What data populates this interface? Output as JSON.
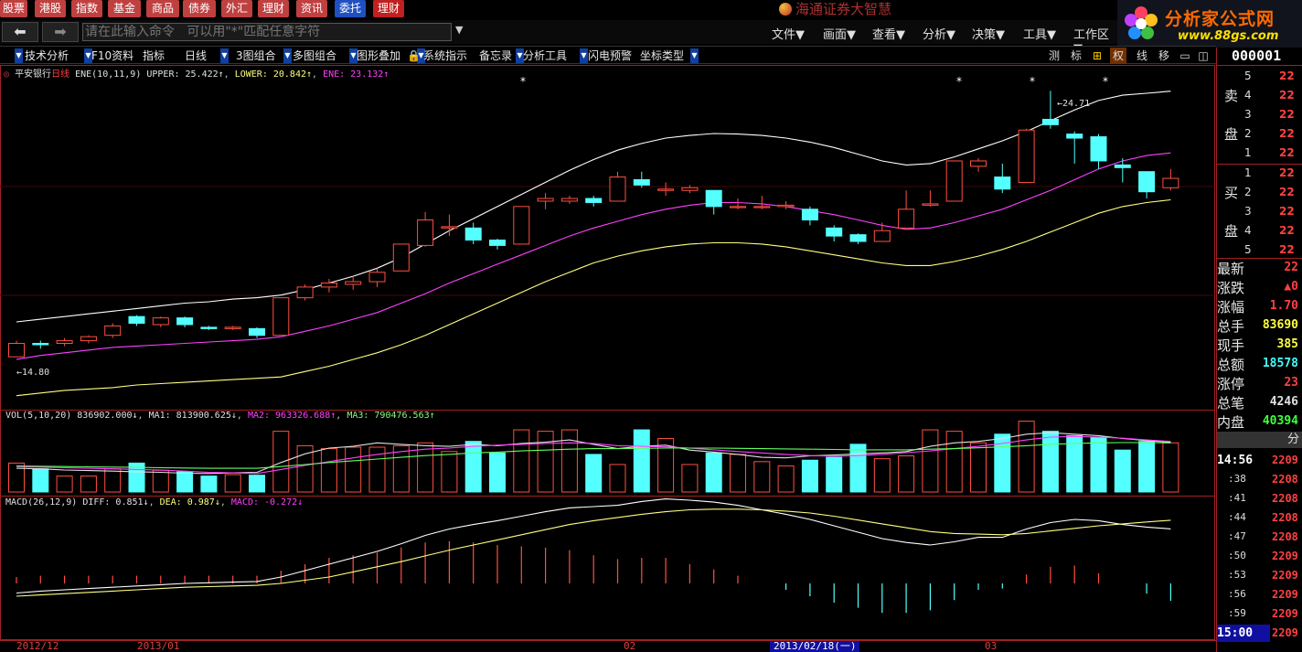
{
  "nav": {
    "tabs": [
      "股票",
      "港股",
      "指数",
      "基金",
      "商品",
      "债券",
      "外汇",
      "理财",
      "资讯",
      "委托",
      "理财"
    ],
    "brand": "海通证券大智慧"
  },
  "site_logo": {
    "title": "分析家公式网",
    "url": "www.88gs.com"
  },
  "command": {
    "placeholder": "请在此输入命令   可以用\"*\"匹配任意字符",
    "menus": [
      "文件▼",
      "画面▼",
      "查看▼",
      "分析▼",
      "决策▼",
      "工具▼",
      "工作区▼"
    ]
  },
  "toolbar": {
    "items": [
      "技术分析",
      "F10资料",
      "指标",
      "日线",
      "3图组合",
      "多图组合",
      "图形叠加",
      "系统指示",
      "备忘录",
      "分析工具",
      "闪电预警",
      "坐标类型"
    ],
    "right_items": [
      "测",
      "标",
      "权",
      "线",
      "移"
    ]
  },
  "stock": {
    "name": "平安银行",
    "period": "日线",
    "code": "000001"
  },
  "ene_legend": {
    "name": "ENE(10,11,9)",
    "upper": "UPPER: 25.422↑",
    "lower": "LOWER: 20.842↑",
    "ene": "ENE: 23.132↑"
  },
  "vol_legend": {
    "name": "VOL(5,10,20)",
    "vol": "836902.000↓",
    "ma1": "MA1: 813900.625↓",
    "ma2": "MA2: 963326.688↑",
    "ma3": "MA3: 790476.563↑"
  },
  "macd_legend": {
    "name": "MACD(26,12,9)",
    "diff": "DIFF: 0.851↓",
    "dea": "DEA: 0.987↓",
    "macd": "MACD: -0.272↓"
  },
  "annotations": {
    "high": "←24.71",
    "low": "←14.80"
  },
  "orderbook": {
    "sell_label": [
      "卖",
      "盘"
    ],
    "buy_label": [
      "买",
      "盘"
    ],
    "sell": [
      {
        "lvl": "5",
        "price": "22"
      },
      {
        "lvl": "4",
        "price": "22"
      },
      {
        "lvl": "3",
        "price": "22"
      },
      {
        "lvl": "2",
        "price": "22"
      },
      {
        "lvl": "1",
        "price": "22"
      }
    ],
    "buy": [
      {
        "lvl": "1",
        "price": "22"
      },
      {
        "lvl": "2",
        "price": "22"
      },
      {
        "lvl": "3",
        "price": "22"
      },
      {
        "lvl": "4",
        "price": "22"
      },
      {
        "lvl": "5",
        "price": "22"
      }
    ]
  },
  "quote": [
    {
      "label": "最新",
      "value": "22",
      "color": "#ff4040"
    },
    {
      "label": "涨跌",
      "value": "▲0",
      "color": "#ff4040"
    },
    {
      "label": "涨幅",
      "value": "1.70",
      "color": "#ff4040"
    },
    {
      "label": "总手",
      "value": "83690",
      "color": "#ffff40"
    },
    {
      "label": "现手",
      "value": "385",
      "color": "#ffff40"
    },
    {
      "label": "总额",
      "value": "18578",
      "color": "#40ffff"
    },
    {
      "label": "涨停",
      "value": "23",
      "color": "#ff4040"
    },
    {
      "label": "总笔",
      "value": "4246",
      "color": "#e0e0e0"
    },
    {
      "label": "内盘",
      "value": "40394",
      "color": "#40ff40"
    }
  ],
  "fen_label": "分",
  "ticks": [
    {
      "t": "14:56",
      "p": "2209"
    },
    {
      "t": ":38",
      "p": "2208"
    },
    {
      "t": ":41",
      "p": "2208"
    },
    {
      "t": ":44",
      "p": "2208"
    },
    {
      "t": ":47",
      "p": "2208"
    },
    {
      "t": ":50",
      "p": "2209"
    },
    {
      "t": ":53",
      "p": "2209"
    },
    {
      "t": ":56",
      "p": "2209"
    },
    {
      "t": ":59",
      "p": "2209"
    },
    {
      "t": "15:00",
      "p": "2209"
    }
  ],
  "dates": [
    "2012/12",
    "2013/01",
    "02",
    "03"
  ],
  "date_selected": "2013/02/18(一)",
  "colors": {
    "up": "#ff5040",
    "down": "#54ffff",
    "upper": "#ffffff",
    "lower": "#ffff80",
    "ene": "#ff40ff",
    "border": "#a02020"
  },
  "chart_data": {
    "type": "candlestick",
    "candles": [
      {
        "o": 14.8,
        "c": 15.3,
        "h": 15.4,
        "l": 14.8
      },
      {
        "o": 15.3,
        "c": 15.25,
        "h": 15.4,
        "l": 15.1
      },
      {
        "o": 15.3,
        "c": 15.4,
        "h": 15.5,
        "l": 15.2
      },
      {
        "o": 15.4,
        "c": 15.55,
        "h": 15.6,
        "l": 15.3
      },
      {
        "o": 15.6,
        "c": 15.95,
        "h": 16.05,
        "l": 15.5
      },
      {
        "o": 16.3,
        "c": 16.05,
        "h": 16.35,
        "l": 15.95
      },
      {
        "o": 16.0,
        "c": 16.25,
        "h": 16.3,
        "l": 15.9
      },
      {
        "o": 16.25,
        "c": 16.0,
        "h": 16.3,
        "l": 15.9
      },
      {
        "o": 15.9,
        "c": 15.85,
        "h": 15.95,
        "l": 15.8
      },
      {
        "o": 15.85,
        "c": 15.9,
        "h": 15.95,
        "l": 15.8
      },
      {
        "o": 15.85,
        "c": 15.6,
        "h": 15.9,
        "l": 15.5
      },
      {
        "o": 15.6,
        "c": 17.0,
        "h": 17.0,
        "l": 15.6
      },
      {
        "o": 17.0,
        "c": 17.4,
        "h": 17.5,
        "l": 16.9
      },
      {
        "o": 17.4,
        "c": 17.55,
        "h": 17.7,
        "l": 17.2
      },
      {
        "o": 17.5,
        "c": 17.6,
        "h": 17.8,
        "l": 17.3
      },
      {
        "o": 17.6,
        "c": 17.95,
        "h": 18.1,
        "l": 17.4
      },
      {
        "o": 18.0,
        "c": 19.0,
        "h": 19.0,
        "l": 18.0
      },
      {
        "o": 18.95,
        "c": 19.9,
        "h": 20.2,
        "l": 18.9
      },
      {
        "o": 19.6,
        "c": 19.65,
        "h": 20.1,
        "l": 19.3
      },
      {
        "o": 19.6,
        "c": 19.15,
        "h": 19.8,
        "l": 19.0
      },
      {
        "o": 19.15,
        "c": 18.95,
        "h": 19.2,
        "l": 18.8
      },
      {
        "o": 19.0,
        "c": 20.4,
        "h": 20.4,
        "l": 19.0
      },
      {
        "o": 20.6,
        "c": 20.7,
        "h": 20.9,
        "l": 20.3
      },
      {
        "o": 20.6,
        "c": 20.7,
        "h": 20.8,
        "l": 20.5
      },
      {
        "o": 20.7,
        "c": 20.55,
        "h": 20.8,
        "l": 20.4
      },
      {
        "o": 20.6,
        "c": 21.5,
        "h": 21.7,
        "l": 20.6
      },
      {
        "o": 21.4,
        "c": 21.2,
        "h": 21.7,
        "l": 21.1
      },
      {
        "o": 21.0,
        "c": 21.05,
        "h": 21.3,
        "l": 20.8
      },
      {
        "o": 21.0,
        "c": 21.1,
        "h": 21.2,
        "l": 20.9
      },
      {
        "o": 21.0,
        "c": 20.4,
        "h": 21.0,
        "l": 20.1
      },
      {
        "o": 20.4,
        "c": 20.4,
        "h": 20.7,
        "l": 20.3
      },
      {
        "o": 20.4,
        "c": 20.4,
        "h": 20.8,
        "l": 20.3
      },
      {
        "o": 20.4,
        "c": 20.45,
        "h": 20.6,
        "l": 20.3
      },
      {
        "o": 20.3,
        "c": 19.9,
        "h": 20.4,
        "l": 19.7
      },
      {
        "o": 19.6,
        "c": 19.3,
        "h": 19.7,
        "l": 19.1
      },
      {
        "o": 19.35,
        "c": 19.1,
        "h": 19.4,
        "l": 19.0
      },
      {
        "o": 19.1,
        "c": 19.5,
        "h": 19.8,
        "l": 19.1
      },
      {
        "o": 19.6,
        "c": 20.3,
        "h": 21.0,
        "l": 19.6
      },
      {
        "o": 20.45,
        "c": 20.5,
        "h": 21.0,
        "l": 20.4
      },
      {
        "o": 20.6,
        "c": 22.1,
        "h": 22.1,
        "l": 20.6
      },
      {
        "o": 21.9,
        "c": 22.1,
        "h": 22.2,
        "l": 21.7
      },
      {
        "o": 21.5,
        "c": 21.05,
        "h": 22.0,
        "l": 20.9
      },
      {
        "o": 21.3,
        "c": 23.25,
        "h": 23.3,
        "l": 21.3
      },
      {
        "o": 23.65,
        "c": 23.45,
        "h": 24.71,
        "l": 23.3
      },
      {
        "o": 23.1,
        "c": 22.95,
        "h": 23.2,
        "l": 22.0
      },
      {
        "o": 23.0,
        "c": 22.1,
        "h": 23.1,
        "l": 21.8
      },
      {
        "o": 21.95,
        "c": 21.85,
        "h": 22.2,
        "l": 21.3
      },
      {
        "o": 21.7,
        "c": 20.95,
        "h": 21.7,
        "l": 20.7
      },
      {
        "o": 21.1,
        "c": 21.45,
        "h": 21.8,
        "l": 21.0
      }
    ],
    "upper": [
      16.1,
      16.2,
      16.3,
      16.4,
      16.5,
      16.6,
      16.7,
      16.8,
      16.85,
      16.95,
      17.0,
      17.1,
      17.3,
      17.55,
      17.8,
      18.1,
      18.5,
      19.0,
      19.5,
      19.95,
      20.4,
      20.85,
      21.3,
      21.75,
      22.15,
      22.5,
      22.75,
      22.95,
      23.05,
      23.12,
      23.1,
      23.05,
      22.95,
      22.8,
      22.6,
      22.35,
      22.1,
      21.95,
      22.0,
      22.25,
      22.55,
      22.85,
      23.2,
      23.6,
      24.0,
      24.35,
      24.55,
      24.62,
      24.7
    ],
    "lower": [
      13.35,
      13.45,
      13.55,
      13.6,
      13.65,
      13.75,
      13.8,
      13.85,
      13.9,
      13.95,
      14.0,
      14.05,
      14.25,
      14.45,
      14.7,
      14.95,
      15.25,
      15.6,
      16.0,
      16.4,
      16.8,
      17.2,
      17.6,
      17.95,
      18.3,
      18.55,
      18.75,
      18.9,
      19.0,
      19.05,
      19.05,
      19.0,
      18.9,
      18.75,
      18.6,
      18.45,
      18.3,
      18.2,
      18.2,
      18.35,
      18.55,
      18.8,
      19.1,
      19.45,
      19.8,
      20.15,
      20.4,
      20.55,
      20.65
    ],
    "ene": [
      14.7,
      14.85,
      14.95,
      15.05,
      15.15,
      15.2,
      15.25,
      15.3,
      15.35,
      15.4,
      15.45,
      15.55,
      15.75,
      15.95,
      16.2,
      16.45,
      16.8,
      17.15,
      17.55,
      17.9,
      18.25,
      18.6,
      18.95,
      19.3,
      19.6,
      19.85,
      20.1,
      20.3,
      20.45,
      20.55,
      20.55,
      20.5,
      20.4,
      20.25,
      20.1,
      19.9,
      19.7,
      19.55,
      19.6,
      19.8,
      20.05,
      20.3,
      20.65,
      21.0,
      21.4,
      21.8,
      22.1,
      22.3,
      22.4
    ],
    "volume": [
      100,
      80,
      55,
      55,
      80,
      100,
      75,
      70,
      55,
      60,
      58,
      210,
      160,
      150,
      155,
      155,
      160,
      170,
      140,
      175,
      135,
      215,
      210,
      215,
      130,
      95,
      215,
      185,
      95,
      135,
      130,
      105,
      90,
      110,
      120,
      165,
      115,
      125,
      215,
      210,
      170,
      200,
      245,
      210,
      195,
      190,
      145,
      175,
      170
    ],
    "ma1": [
      82,
      80,
      76,
      74,
      72,
      70,
      68,
      65,
      64,
      66,
      68,
      102,
      132,
      152,
      158,
      170,
      165,
      160,
      158,
      165,
      160,
      168,
      172,
      180,
      165,
      150,
      158,
      162,
      145,
      138,
      130,
      120,
      118,
      125,
      128,
      132,
      135,
      140,
      158,
      170,
      175,
      185,
      200,
      205,
      200,
      195,
      185,
      178,
      172
    ],
    "ma2": [
      88,
      86,
      84,
      82,
      80,
      78,
      76,
      72,
      68,
      66,
      64,
      78,
      92,
      105,
      118,
      130,
      140,
      148,
      152,
      158,
      162,
      165,
      168,
      170,
      168,
      160,
      158,
      156,
      152,
      146,
      140,
      135,
      130,
      126,
      124,
      126,
      130,
      136,
      142,
      150,
      158,
      168,
      180,
      190,
      192,
      190,
      186,
      180,
      175
    ],
    "ma3": [
      90,
      89,
      88,
      87,
      86,
      85,
      84,
      83,
      82,
      82,
      82,
      88,
      95,
      102,
      108,
      114,
      120,
      126,
      130,
      135,
      138,
      142,
      145,
      148,
      150,
      150,
      151,
      152,
      152,
      152,
      151,
      150,
      149,
      148,
      147,
      146,
      146,
      146,
      148,
      150,
      153,
      156,
      160,
      165,
      168,
      170,
      171,
      171,
      170
    ],
    "diff": [
      -0.15,
      -0.12,
      -0.1,
      -0.08,
      -0.06,
      -0.04,
      -0.02,
      0.0,
      0.01,
      0.02,
      0.03,
      0.1,
      0.2,
      0.3,
      0.4,
      0.5,
      0.62,
      0.75,
      0.85,
      0.92,
      0.98,
      1.05,
      1.12,
      1.18,
      1.2,
      1.22,
      1.28,
      1.32,
      1.3,
      1.27,
      1.22,
      1.15,
      1.08,
      1.0,
      0.9,
      0.8,
      0.7,
      0.64,
      0.6,
      0.65,
      0.72,
      0.72,
      0.85,
      0.95,
      1.0,
      0.98,
      0.92,
      0.88,
      0.851
    ],
    "dea": [
      -0.2,
      -0.18,
      -0.16,
      -0.14,
      -0.12,
      -0.1,
      -0.08,
      -0.06,
      -0.05,
      -0.04,
      -0.03,
      0.0,
      0.05,
      0.1,
      0.18,
      0.26,
      0.34,
      0.43,
      0.52,
      0.6,
      0.68,
      0.76,
      0.84,
      0.92,
      0.98,
      1.03,
      1.08,
      1.12,
      1.15,
      1.16,
      1.16,
      1.15,
      1.13,
      1.1,
      1.05,
      0.99,
      0.93,
      0.87,
      0.81,
      0.78,
      0.77,
      0.76,
      0.78,
      0.82,
      0.86,
      0.9,
      0.93,
      0.96,
      0.987
    ],
    "macd": [
      0.1,
      0.12,
      0.12,
      0.12,
      0.12,
      0.12,
      0.12,
      0.12,
      0.12,
      0.12,
      0.12,
      0.2,
      0.3,
      0.4,
      0.44,
      0.48,
      0.56,
      0.64,
      0.66,
      0.64,
      0.6,
      0.58,
      0.56,
      0.52,
      0.44,
      0.38,
      0.4,
      0.4,
      0.3,
      0.22,
      0.12,
      0.0,
      -0.1,
      -0.2,
      -0.3,
      -0.38,
      -0.46,
      -0.46,
      -0.42,
      -0.26,
      -0.1,
      -0.08,
      0.14,
      0.26,
      0.28,
      0.16,
      0.0,
      -0.16,
      -0.272
    ]
  }
}
